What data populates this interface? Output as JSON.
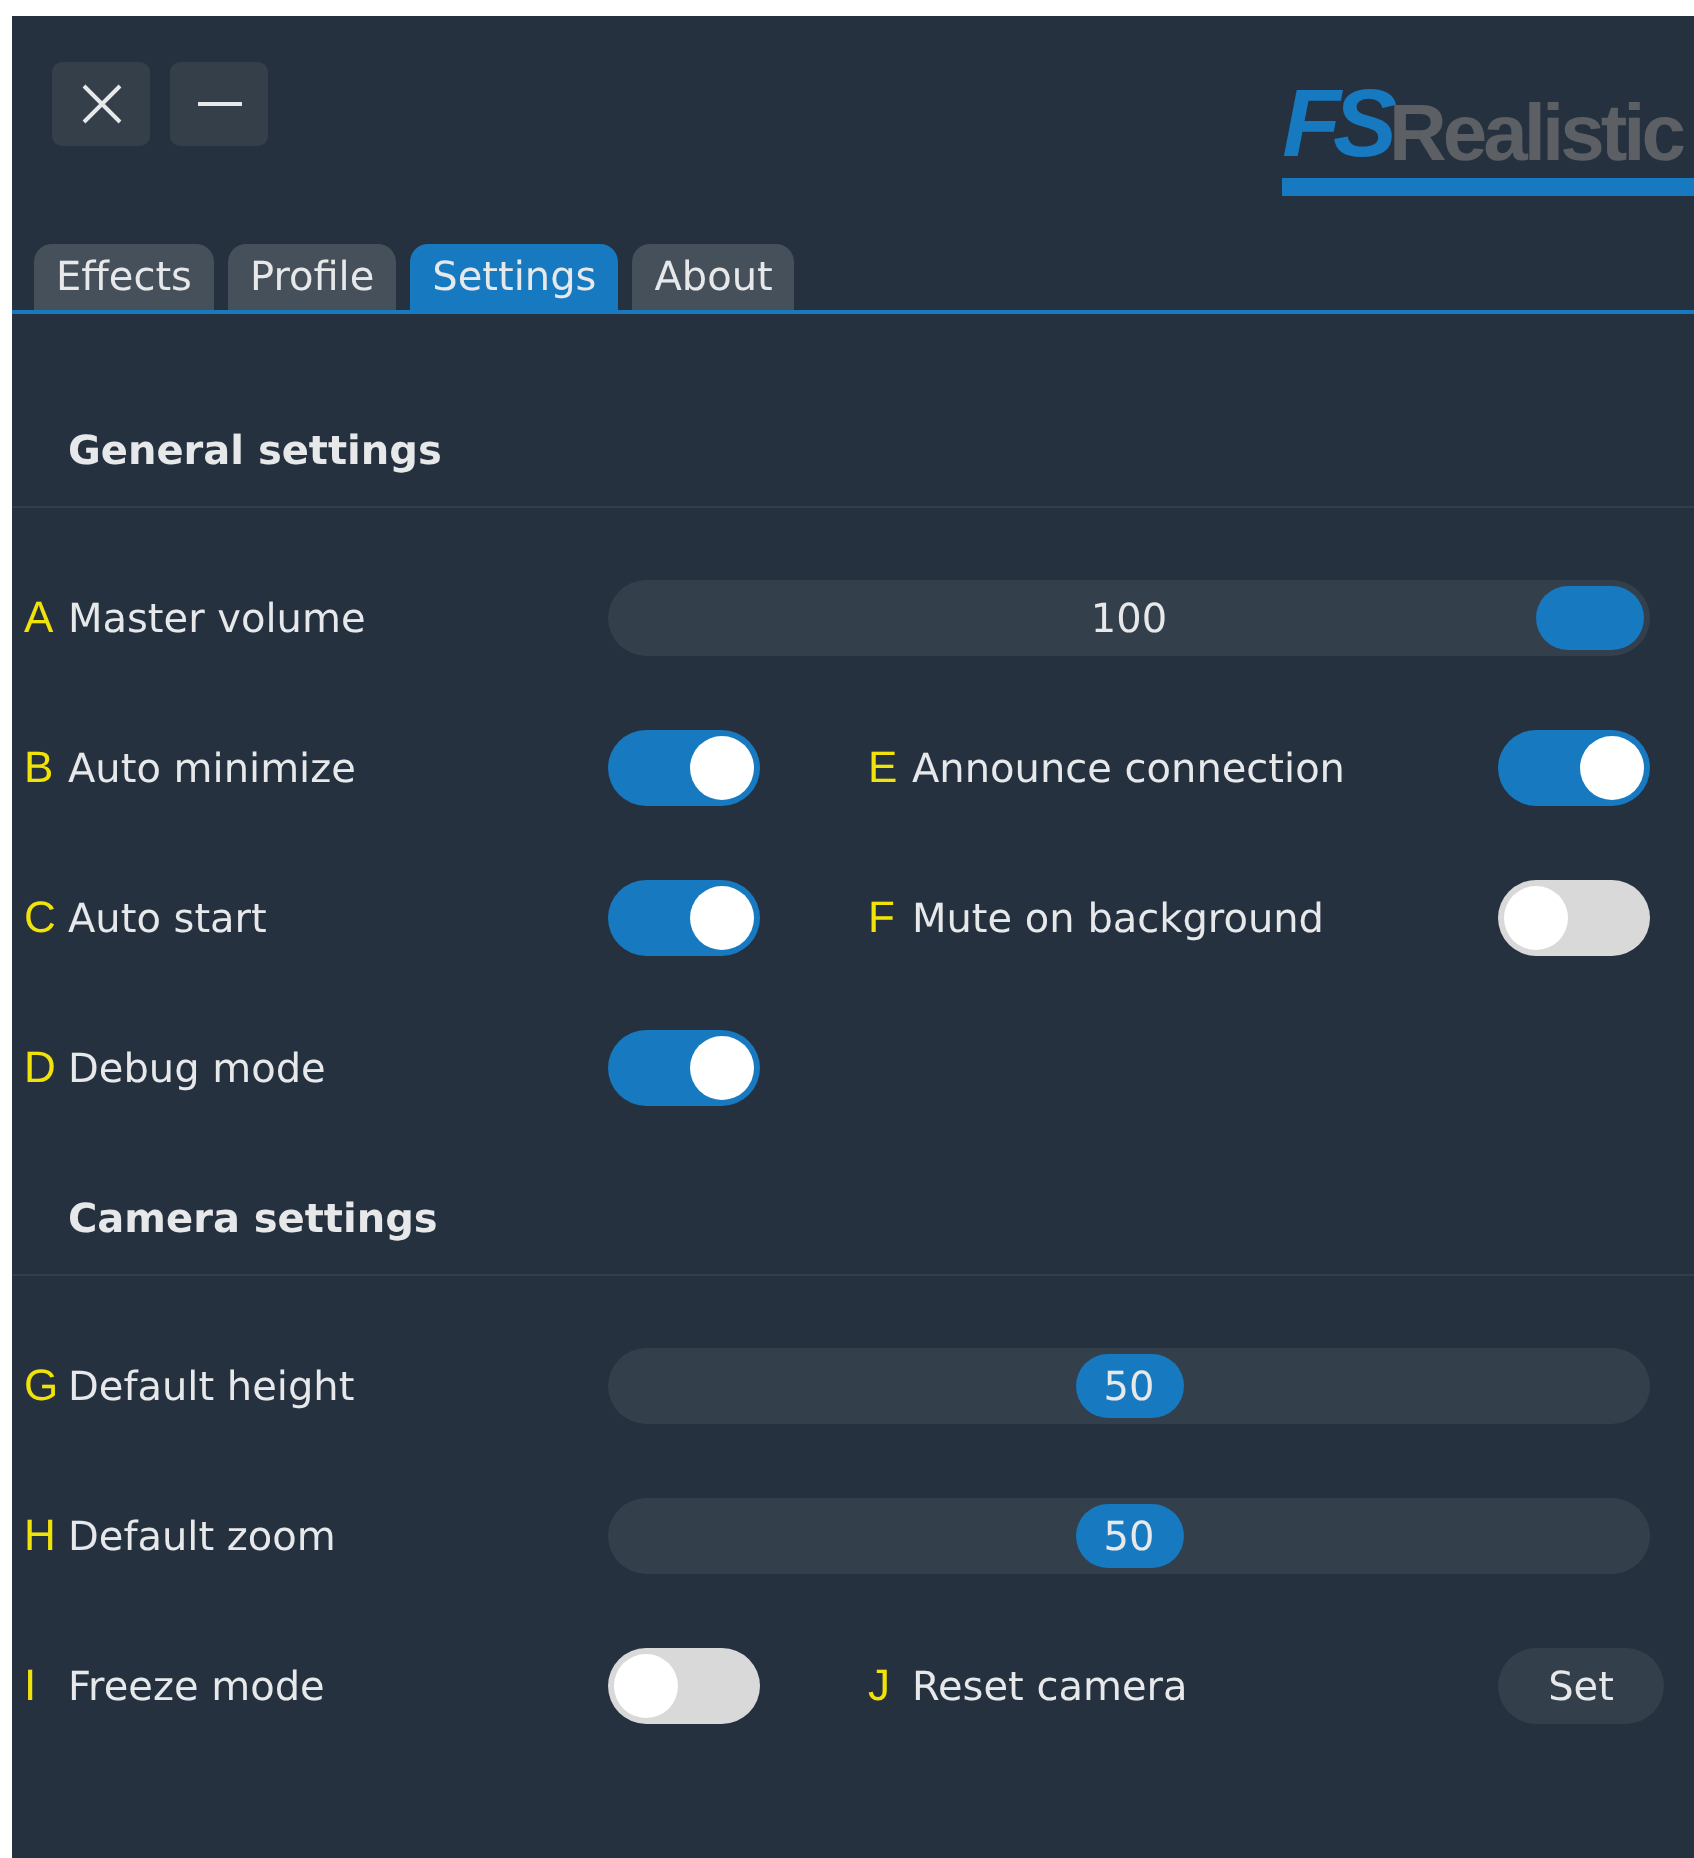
{
  "window": {
    "controls": [
      {
        "kind": "close"
      },
      {
        "kind": "minimize"
      }
    ]
  },
  "logo": {
    "mark": "FS",
    "name": "Realistic"
  },
  "tabs": [
    {
      "label": "Effects",
      "selected": false
    },
    {
      "label": "Profile",
      "selected": false
    },
    {
      "label": "Settings",
      "selected": true
    },
    {
      "label": "About",
      "selected": false
    }
  ],
  "sections": [
    {
      "title": "General settings",
      "rows": [
        [
          {
            "marker": "A",
            "label": "Master volume",
            "kind": "slider",
            "level": 1,
            "value": "100"
          }
        ],
        [
          {
            "marker": "B",
            "label": "Auto minimize",
            "kind": "toggle",
            "on": true
          },
          {
            "marker": "E",
            "label": "Announce connection",
            "kind": "toggle",
            "on": true
          }
        ],
        [
          {
            "marker": "C",
            "label": "Auto start",
            "kind": "toggle",
            "on": true
          },
          {
            "marker": "F",
            "label": "Mute on background",
            "kind": "toggle",
            "on": false
          }
        ],
        [
          {
            "marker": "D",
            "label": "Debug mode",
            "kind": "toggle",
            "on": true
          }
        ]
      ]
    },
    {
      "title": "Camera settings",
      "rows": [
        [
          {
            "marker": "G",
            "label": "Default height",
            "kind": "slider",
            "level": 0.5,
            "value": "50"
          }
        ],
        [
          {
            "marker": "H",
            "label": "Default zoom",
            "kind": "slider",
            "level": 0.5,
            "value": "50"
          }
        ],
        [
          {
            "marker": "I",
            "label": "Freeze mode",
            "kind": "toggle",
            "on": false
          },
          {
            "marker": "J",
            "label": "Reset camera",
            "kind": "button",
            "button": "Set"
          }
        ]
      ]
    }
  ]
}
